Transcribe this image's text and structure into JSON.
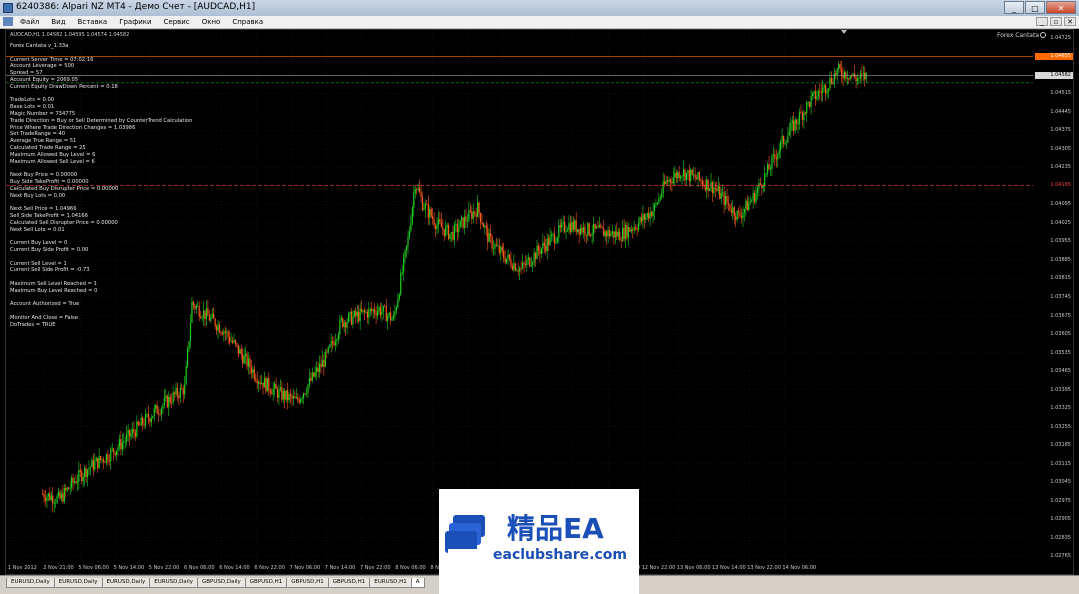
{
  "window": {
    "title": "6240386: Alpari NZ MT4 - Демо Счет - [AUDCAD,H1]",
    "minimize": "_",
    "maximize": "□",
    "close": "✕"
  },
  "menu": [
    "Файл",
    "Вид",
    "Вставка",
    "Графики",
    "Сервис",
    "Окно",
    "Справка"
  ],
  "mdi_controls": [
    "_",
    "▫",
    "✕"
  ],
  "chart": {
    "ohlc": "AUDCAD,H1  1.04582 1.04595 1.04574 1.04582",
    "ea_name": "Forex Cantata",
    "colors": {
      "bull": "#1fd11f",
      "bear": "#ff5a1e",
      "background": "#000000",
      "grid": "#1d1d1d"
    },
    "info_lines": [
      "Forex Cantata  v_1.33a",
      "",
      "Current Server Time = 07:02:16",
      "Account Leverage = 500",
      "Spread = 57",
      "Account Equity = 2069.05",
      "Current Equity DrawDown Percent = 0.18",
      "",
      "TradeLots = 0.00",
      "Base Lots = 0.01",
      "Magic Number = 734775",
      "Trade Direction = Buy or Sell Determined by CounterTrend Calculation",
      "Price Where Trade Direction Changes = 1.03986",
      "Set TradeRange = 40",
      "Average True Range = 51",
      "Calculated Trade Range = 25",
      "Maximum Allowed Buy Level = 6",
      "Maximum Allowed Sell Level = 6",
      "",
      "Next Buy Price = 0.00000",
      "Buy Side TakeProfit = 0.00000",
      "Calculated Buy Disrupter Price = 0.00000",
      "Next Buy Lots = 0.00",
      "",
      "Next Sell Price = 1.04966",
      "Sell Side TakeProfit = 1.04166",
      "Calculated Sell Disrupter Price = 0.00000",
      "Next Sell Lots = 0.01",
      "",
      "Current Buy Level = 0",
      "Current Buy Side Profit = 0.00",
      "",
      "Current Sell Level = 1",
      "Current Sell Side Profit = -0.73",
      "",
      "Maximum Sell Level Reached = 1",
      "Maximum Buy Level Reached = 0",
      "",
      "Account Authorized = True",
      "",
      "Monitor And Close = False",
      "DoTrades = TRUE"
    ],
    "price_ticks": [
      "1.04725",
      "1.04655",
      "1.04585",
      "1.04515",
      "1.04445",
      "1.04375",
      "1.04305",
      "1.04235",
      "1.04165",
      "1.04095",
      "1.04025",
      "1.03955",
      "1.03885",
      "1.03815",
      "1.03745",
      "1.03675",
      "1.03605",
      "1.03535",
      "1.03465",
      "1.03395",
      "1.03325",
      "1.03255",
      "1.03185",
      "1.03115",
      "1.03045",
      "1.02975",
      "1.02905",
      "1.02835",
      "1.02765"
    ],
    "price_tags": [
      {
        "text": "1.04655",
        "color": "#ff6a00",
        "line": "solid"
      },
      {
        "text": "1.04582",
        "color": "#d8d8d8",
        "line": "solid"
      },
      {
        "text": "1.04165",
        "color": "#ff3b3b",
        "line": "dash"
      }
    ],
    "line_levels": [
      1.04655,
      1.04582,
      1.04555,
      1.04166
    ],
    "time_ticks": [
      "1 Nov 2012",
      "2 Nov 21:00",
      "5 Nov 06:00",
      "5 Nov 14:00",
      "5 Nov 22:00",
      "6 Nov 06:00",
      "6 Nov 14:00",
      "6 Nov 22:00",
      "7 Nov 06:00",
      "7 Nov 14:00",
      "7 Nov 22:00",
      "8 Nov 06:00",
      "8 Nov 14:00",
      "8 Nov 22:00",
      "9 Nov 06:00",
      "9 Nov 14:00",
      "12 Nov 06:00",
      "12 Nov 14:00",
      "12 Nov 22:00",
      "13 Nov 06:00",
      "13 Nov 14:00",
      "13 Nov 22:00",
      "14 Nov 06:00"
    ]
  },
  "chart_data": {
    "type": "candlestick",
    "symbol": "AUDCAD",
    "timeframe": "H1",
    "ylim": [
      1.02735,
      1.04755
    ],
    "current_price": 1.04582,
    "levels": {
      "ask": 1.04655,
      "bid": 1.04582,
      "sell_take_profit": 1.04166
    },
    "close_path": [
      [
        0,
        1.03
      ],
      [
        12,
        1.0298
      ],
      [
        22,
        1.0305
      ],
      [
        32,
        1.031
      ],
      [
        46,
        1.0315
      ],
      [
        60,
        1.0322
      ],
      [
        75,
        1.033
      ],
      [
        88,
        1.0336
      ],
      [
        98,
        1.034
      ],
      [
        103,
        1.0372
      ],
      [
        112,
        1.0368
      ],
      [
        125,
        1.0362
      ],
      [
        138,
        1.0352
      ],
      [
        150,
        1.0343
      ],
      [
        163,
        1.0338
      ],
      [
        175,
        1.0335
      ],
      [
        184,
        1.0342
      ],
      [
        196,
        1.0352
      ],
      [
        206,
        1.0365
      ],
      [
        220,
        1.0368
      ],
      [
        232,
        1.037
      ],
      [
        242,
        1.0366
      ],
      [
        246,
        1.0378
      ],
      [
        252,
        1.0396
      ],
      [
        257,
        1.0418
      ],
      [
        262,
        1.041
      ],
      [
        272,
        1.0402
      ],
      [
        282,
        1.0398
      ],
      [
        292,
        1.0404
      ],
      [
        300,
        1.0408
      ],
      [
        308,
        1.0396
      ],
      [
        318,
        1.039
      ],
      [
        330,
        1.0385
      ],
      [
        342,
        1.0392
      ],
      [
        352,
        1.0397
      ],
      [
        362,
        1.0402
      ],
      [
        374,
        1.04
      ],
      [
        386,
        1.0399
      ],
      [
        398,
        1.0398
      ],
      [
        410,
        1.0402
      ],
      [
        422,
        1.0408
      ],
      [
        430,
        1.0418
      ],
      [
        440,
        1.0422
      ],
      [
        452,
        1.0419
      ],
      [
        463,
        1.0416
      ],
      [
        472,
        1.041
      ],
      [
        480,
        1.0405
      ],
      [
        490,
        1.0412
      ],
      [
        500,
        1.0422
      ],
      [
        510,
        1.0433
      ],
      [
        520,
        1.0441
      ],
      [
        530,
        1.0449
      ],
      [
        540,
        1.0454
      ],
      [
        548,
        1.046
      ],
      [
        555,
        1.0459
      ],
      [
        562,
        1.0457
      ],
      [
        568,
        1.0458
      ]
    ]
  },
  "tabs": [
    "EURUSD,Daily",
    "EURUSD,Daily",
    "EURUSD,Daily",
    "EURUSD,Daily",
    "GBPUSD,Daily",
    "GBPUSD,H1",
    "GBPUSD,H1",
    "GBPUSD,H1",
    "EURUSD,H1",
    "A"
  ],
  "watermark": {
    "title": "精品EA",
    "site": "eaclubshare.com"
  }
}
